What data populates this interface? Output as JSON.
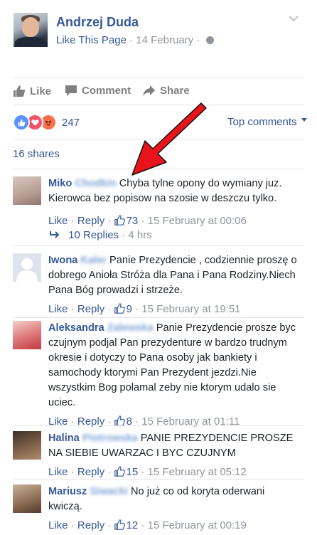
{
  "post": {
    "page_name": "Andrzej Duda",
    "like_page": "Like This Page",
    "date": "14 February",
    "dot": "·"
  },
  "actions": {
    "like": "Like",
    "comment": "Comment",
    "share": "Share"
  },
  "reactions": {
    "count": "247",
    "top_comments": "Top comments"
  },
  "shares": "16 shares",
  "comments": [
    {
      "first": "Miko",
      "surname": "Chodkin",
      "text": "Chyba tylne opony do wymiany juz. Kierowca bez popisow na szosie w deszczu tylko.",
      "like": "Like",
      "reply": "Reply",
      "likes": "73",
      "time": "15 February at 00:06"
    },
    {
      "first": "Iwona",
      "surname": "Kaler",
      "text": "Panie Prezydencie , codziennie proszę o dobrego Anioła Stróża dla Pana i Pana Rodziny.Niech Pana Bóg prowadzi i strzeże.",
      "like": "Like",
      "reply": "Reply",
      "likes": "9",
      "time": "15 February at 19:51"
    },
    {
      "first": "Aleksandra",
      "surname": "Zalewska",
      "text": "Panie Prezydencie prosze byc czujnym podjal Pan prezydenture w bardzo trudnym okresie i dotyczy to Pana osoby jak bankiety i samochody ktorymi Pan Prezydent jezdzi.Nie wszystkim Bog polamal zeby nie ktorym udalo sie uciec.",
      "like": "Like",
      "reply": "Reply",
      "likes": "8",
      "time": "15 February at 01:11"
    },
    {
      "first": "Halina",
      "surname": "Piotrowska",
      "text": "PANIE PREZYDENCIE PROSZE NA SIEBIE UWARZAC I BYC CZUJNYM",
      "like": "Like",
      "reply": "Reply",
      "likes": "15",
      "time": "15 February at 05:12"
    },
    {
      "first": "Mariusz",
      "surname": "Siwacki",
      "text": "No już co od koryta oderwani kwiczą.",
      "like": "Like",
      "reply": "Reply",
      "likes": "12",
      "time": "15 February at 00:19"
    }
  ],
  "replies": {
    "label": "10 Replies",
    "time": "4 hrs"
  },
  "colors": {
    "link": "#365899",
    "muted": "#90949c",
    "arrow": "#e8141b"
  }
}
